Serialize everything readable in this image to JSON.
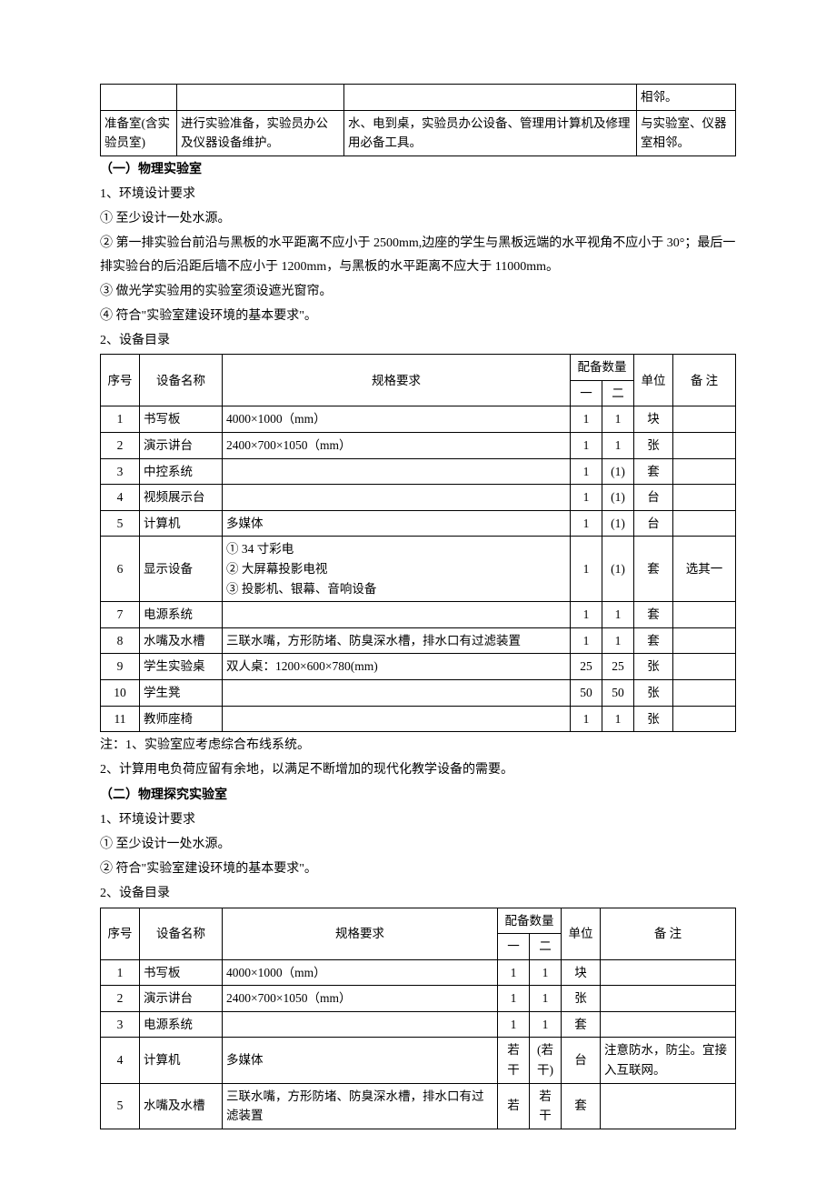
{
  "intro_table": {
    "row1": {
      "c1": "",
      "c2": "",
      "c3": "",
      "c4": "相邻。"
    },
    "row2": {
      "c1": "准备室(含实验员室)",
      "c2": "进行实验准备，实验员办公及仪器设备维护。",
      "c3": "水、电到桌，实验员办公设备、管理用计算机及修理用必备工具。",
      "c4": "与实验室、仪器室相邻。"
    }
  },
  "sec1": {
    "title": "（一）物理实验室",
    "env_label": "1、环境设计要求",
    "env1": "① 至少设计一处水源。",
    "env2": "② 第一排实验台前沿与黑板的水平距离不应小于 2500mm,边座的学生与黑板远端的水平视角不应小于 30°；最后一排实验台的后沿距后墙不应小于 1200mm，与黑板的水平距离不应大于 11000mm。",
    "env3": "③ 做光学实验用的实验室须设遮光窗帘。",
    "env4": "④ 符合\"实验室建设环境的基本要求\"。",
    "equip_label": "2、设备目录",
    "headers": {
      "seq": "序号",
      "name": "设备名称",
      "spec": "规格要求",
      "qty": "配备数量",
      "qty1": "一",
      "qty2": "二",
      "unit": "单位",
      "remark": "备 注"
    },
    "rows": [
      {
        "seq": "1",
        "name": "书写板",
        "spec": "4000×1000（mm）",
        "q1": "1",
        "q2": "1",
        "unit": "块",
        "remark": ""
      },
      {
        "seq": "2",
        "name": "演示讲台",
        "spec": "2400×700×1050（mm）",
        "q1": "1",
        "q2": "1",
        "unit": "张",
        "remark": ""
      },
      {
        "seq": "3",
        "name": "中控系统",
        "spec": "",
        "q1": "1",
        "q2": "(1)",
        "unit": "套",
        "remark": ""
      },
      {
        "seq": "4",
        "name": "视频展示台",
        "spec": "",
        "q1": "1",
        "q2": "(1)",
        "unit": "台",
        "remark": ""
      },
      {
        "seq": "5",
        "name": "计算机",
        "spec": "多媒体",
        "q1": "1",
        "q2": "(1)",
        "unit": "台",
        "remark": ""
      },
      {
        "seq": "6",
        "name": "显示设备",
        "spec": "① 34 寸彩电\n② 大屏幕投影电视\n③ 投影机、银幕、音响设备",
        "q1": "1",
        "q2": "(1)",
        "unit": "套",
        "remark": "选其一"
      },
      {
        "seq": "7",
        "name": "电源系统",
        "spec": "",
        "q1": "1",
        "q2": "1",
        "unit": "套",
        "remark": ""
      },
      {
        "seq": "8",
        "name": "水嘴及水槽",
        "spec": "三联水嘴，方形防堵、防臭深水槽，排水口有过滤装置",
        "q1": "1",
        "q2": "1",
        "unit": "套",
        "remark": ""
      },
      {
        "seq": "9",
        "name": "学生实验桌",
        "spec": "双人桌：1200×600×780(mm)",
        "q1": "25",
        "q2": "25",
        "unit": "张",
        "remark": ""
      },
      {
        "seq": "10",
        "name": "学生凳",
        "spec": "",
        "q1": "50",
        "q2": "50",
        "unit": "张",
        "remark": ""
      },
      {
        "seq": "11",
        "name": "教师座椅",
        "spec": "",
        "q1": "1",
        "q2": "1",
        "unit": "张",
        "remark": ""
      }
    ],
    "note1": "注：1、实验室应考虑综合布线系统。",
    "note2": "2、计算用电负荷应留有余地，以满足不断增加的现代化教学设备的需要。"
  },
  "sec2": {
    "title": "（二）物理探究实验室",
    "env_label": "1、环境设计要求",
    "env1": "① 至少设计一处水源。",
    "env2": "② 符合\"实验室建设环境的基本要求\"。",
    "equip_label": "2、设备目录",
    "headers": {
      "seq": "序号",
      "name": "设备名称",
      "spec": "规格要求",
      "qty": "配备数量",
      "qty1": "一",
      "qty2": "二",
      "unit": "单位",
      "remark": "备 注"
    },
    "rows": [
      {
        "seq": "1",
        "name": "书写板",
        "spec": "4000×1000（mm）",
        "q1": "1",
        "q2": "1",
        "unit": "块",
        "remark": ""
      },
      {
        "seq": "2",
        "name": "演示讲台",
        "spec": "2400×700×1050（mm）",
        "q1": "1",
        "q2": "1",
        "unit": "张",
        "remark": ""
      },
      {
        "seq": "3",
        "name": "电源系统",
        "spec": "",
        "q1": "1",
        "q2": "1",
        "unit": "套",
        "remark": ""
      },
      {
        "seq": "4",
        "name": "计算机",
        "spec": "多媒体",
        "q1": "若干",
        "q2": "(若干)",
        "unit": "台",
        "remark": "注意防水，防尘。宜接入互联网。"
      },
      {
        "seq": "5",
        "name": "水嘴及水槽",
        "spec": "三联水嘴，方形防堵、防臭深水槽，排水口有过滤装置",
        "q1": "若",
        "q2": "若干",
        "unit": "套",
        "remark": ""
      }
    ]
  }
}
